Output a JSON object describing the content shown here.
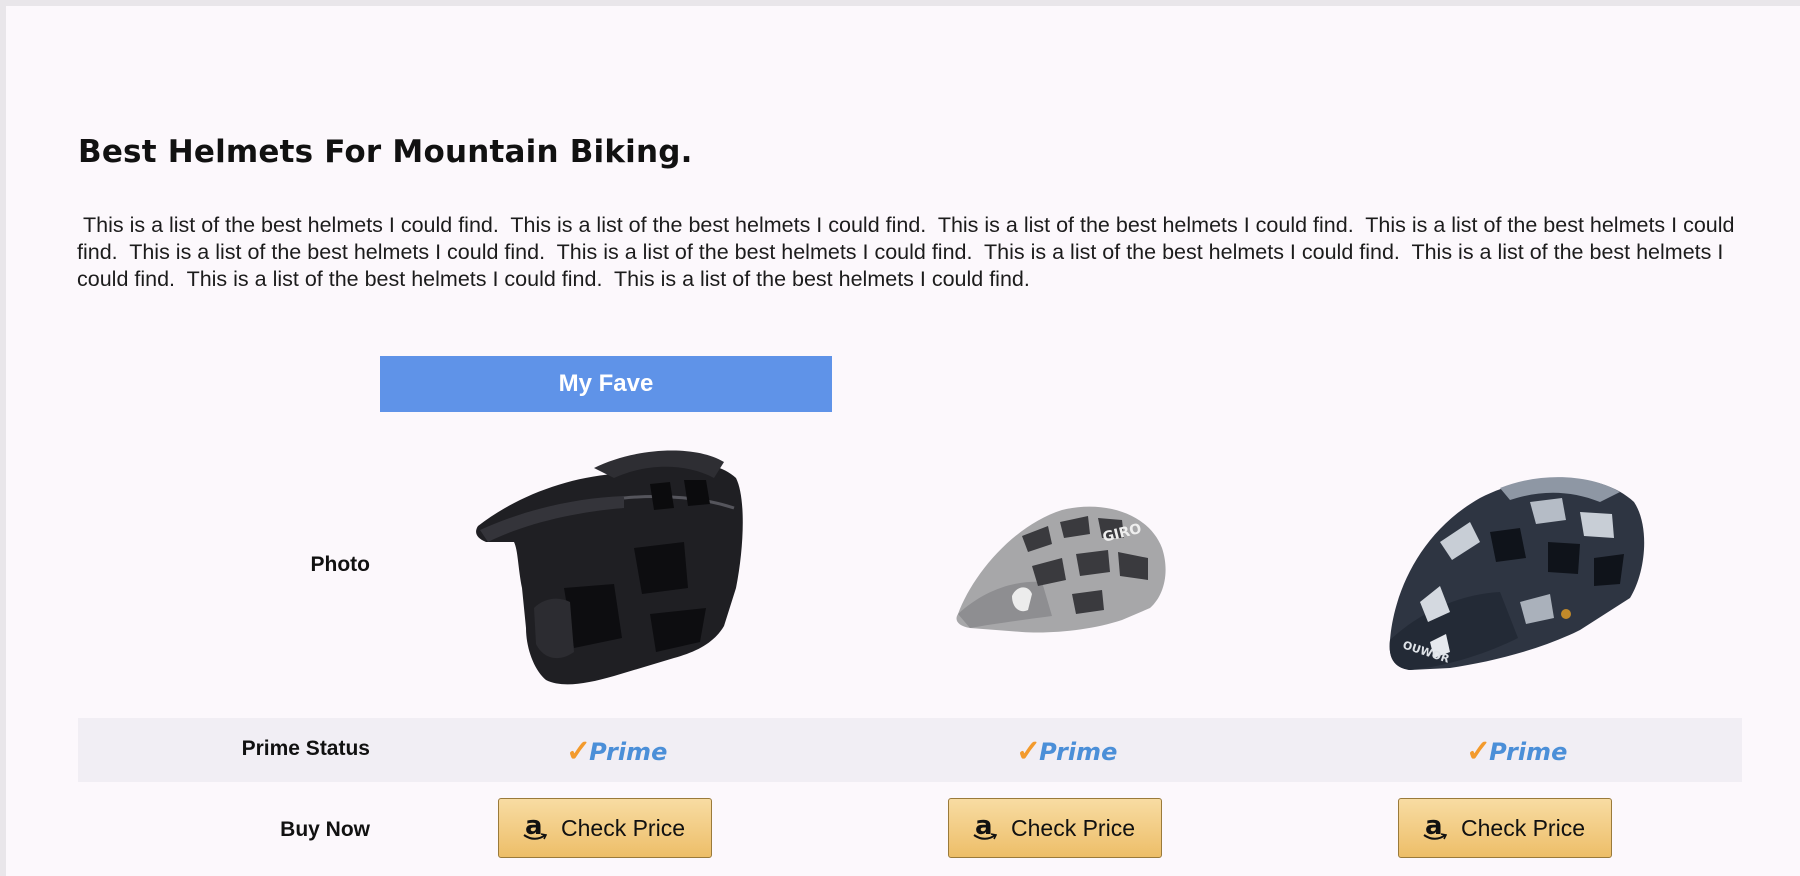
{
  "article": {
    "title": "Best Helmets For Mountain Biking.",
    "intro": " This is a list of the best helmets I could find.  This is a list of the best helmets I could find.  This is a list of the best helmets I could find.  This is a list of the best helmets I could find.  This is a list of the best helmets I could find.  This is a list of the best helmets I could find.  This is a list of the best helmets I could find.  This is a list of the best helmets I could find.  This is a list of the best helmets I could find.  This is a list of the best helmets I could find."
  },
  "table": {
    "fave_label": "My Fave",
    "row_labels": {
      "photo": "Photo",
      "prime": "Prime Status",
      "buy": "Buy Now"
    },
    "products": [
      {
        "icon": "full-face-mtb-helmet-icon",
        "color": "#1e1e22",
        "prime": "Prime",
        "button": "Check Price"
      },
      {
        "icon": "grey-trail-helmet-icon",
        "color": "#9a9a9c",
        "prime": "Prime",
        "button": "Check Price"
      },
      {
        "icon": "camo-trail-helmet-icon",
        "color": "#2d3442",
        "prime": "Prime",
        "button": "Check Price",
        "brand": "OUWOR"
      }
    ]
  },
  "colors": {
    "banner": "#5f93e8",
    "prime_check": "#f39a2c",
    "prime_text": "#4b8fd8",
    "button": "#f0c46f"
  },
  "amazon_logo": "a"
}
